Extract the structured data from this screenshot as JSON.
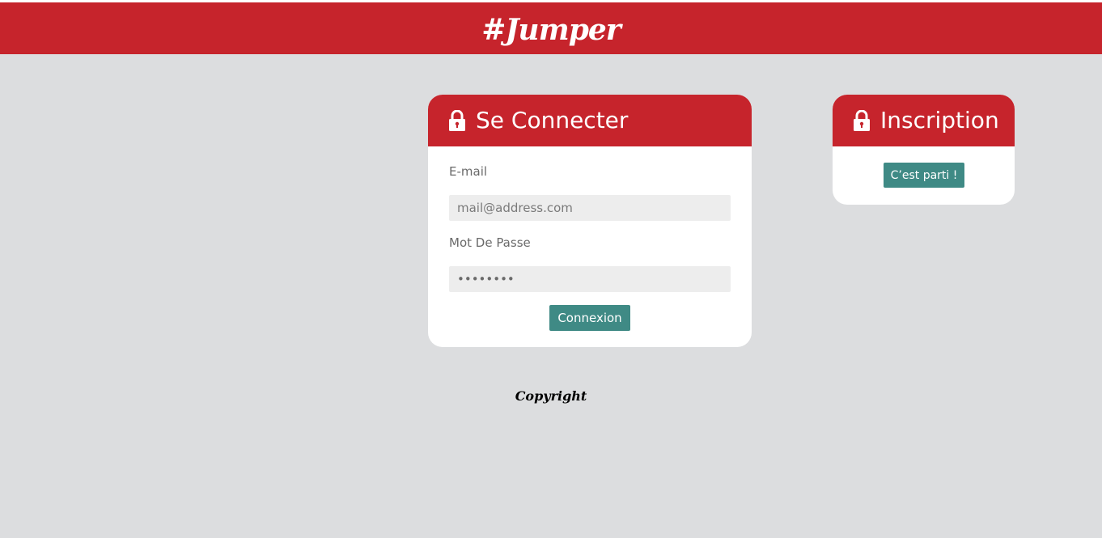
{
  "header": {
    "brand": "#Jumper"
  },
  "login": {
    "title": "Se Connecter",
    "icon": "lock-icon",
    "email_label": "E-mail",
    "email_placeholder": "mail@address.com",
    "password_label": "Mot De Passe",
    "password_value": "••••••••",
    "submit_label": "Connexion"
  },
  "signup": {
    "title": "Inscription",
    "icon": "lock-icon",
    "button_label": "C’est parti !"
  },
  "footer": {
    "text": "Copyright"
  },
  "colors": {
    "brand_red": "#c6242c",
    "button_teal": "#3f8a85",
    "page_bg": "#dcdddf"
  }
}
